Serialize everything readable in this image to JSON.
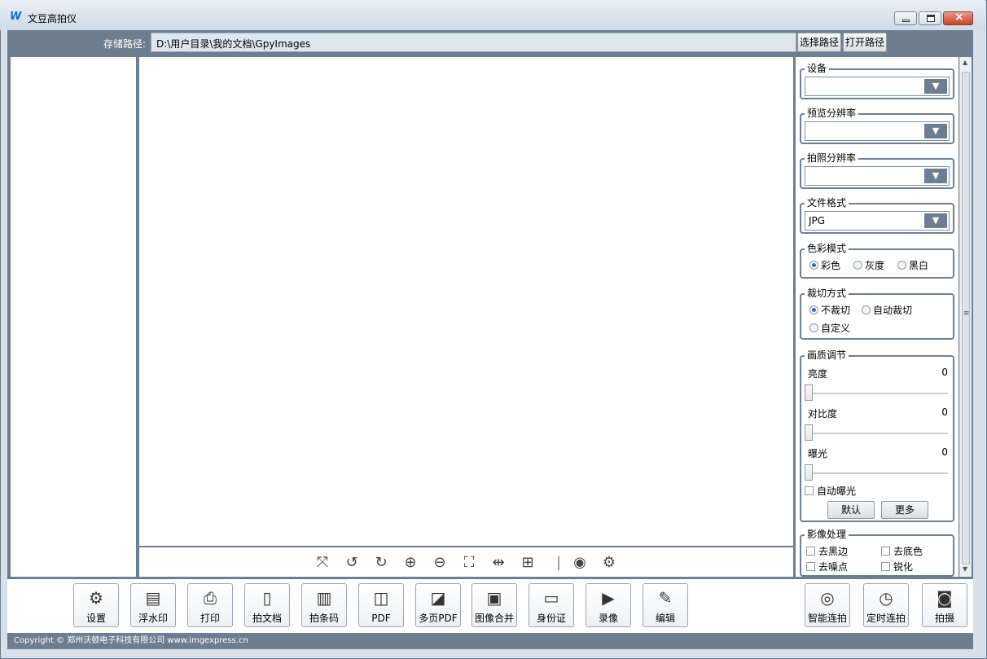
{
  "window": {
    "title": "文豆高拍仪",
    "app_icon": "app-logo-icon"
  },
  "path_bar": {
    "label": "存储路径:",
    "value": "D:\\用户目录\\我的文档\\GpyImages",
    "select_btn": "选择路径",
    "open_btn": "打开路径"
  },
  "settings": {
    "device": {
      "title": "设备",
      "value": ""
    },
    "preview_res": {
      "title": "预览分辨率",
      "value": ""
    },
    "capture_res": {
      "title": "拍照分辨率",
      "value": ""
    },
    "file_format": {
      "title": "文件格式",
      "value": "JPG"
    },
    "color_mode": {
      "title": "色彩模式",
      "options": [
        "彩色",
        "灰度",
        "黑白"
      ],
      "selected": "彩色"
    },
    "crop_mode": {
      "title": "裁切方式",
      "options": [
        "不裁切",
        "自动裁切",
        "自定义"
      ],
      "selected": "不裁切"
    },
    "quality": {
      "title": "画质调节",
      "brightness_label": "亮度",
      "brightness": "0",
      "contrast_label": "对比度",
      "contrast": "0",
      "exposure_label": "曝光",
      "exposure": "0",
      "auto_exposure": "自动曝光",
      "default_btn": "默认",
      "more_btn": "更多"
    },
    "image_proc": {
      "title": "影像处理",
      "remove_black_border": "去黑边",
      "remove_background": "去底色",
      "denoise": "去噪点",
      "sharpen": "锐化"
    }
  },
  "toolbar": {
    "settings": "设置",
    "watermark": "浮水印",
    "print": "打印",
    "capture_doc": "拍文档",
    "barcode": "拍条码",
    "pdf": "PDF",
    "multi_pdf": "多页PDF",
    "merge": "图像合并",
    "id_card": "身份证",
    "record": "录像",
    "edit": "编辑",
    "smart_burst": "智能连拍",
    "timed_burst": "定时连拍",
    "capture": "拍摄"
  },
  "status": {
    "copyright": "Copyright © 郑州沃顿电子科技有限公司 www.imgexpress.cn"
  },
  "colors": {
    "frame": "#6e7e91",
    "accent": "#2d62b4"
  }
}
